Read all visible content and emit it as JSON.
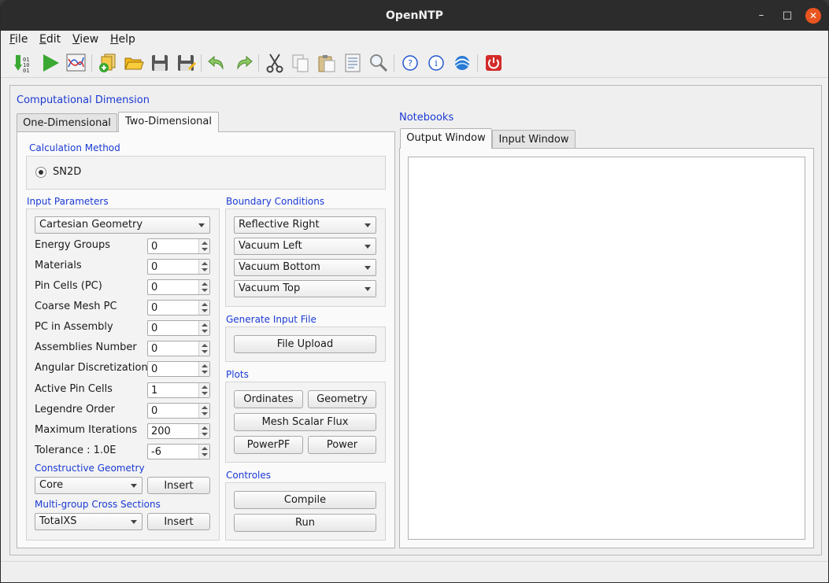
{
  "window": {
    "title": "OpenNTP"
  },
  "menu": [
    {
      "label": "File",
      "mnemonic": "F",
      "rest": "ile"
    },
    {
      "label": "Edit",
      "mnemonic": "E",
      "rest": "dit"
    },
    {
      "label": "View",
      "mnemonic": "V",
      "rest": "iew"
    },
    {
      "label": "Help",
      "mnemonic": "H",
      "rest": "elp"
    }
  ],
  "toolbar": {
    "icons": [
      "import-binary-icon",
      "run-icon",
      "plot-icon",
      "add-files-icon",
      "open-folder-icon",
      "save-icon",
      "save-as-icon",
      "undo-icon",
      "redo-icon",
      "cut-icon",
      "copy-icon",
      "paste-icon",
      "document-icon",
      "search-icon",
      "help-icon",
      "info-icon",
      "web-icon",
      "power-icon"
    ],
    "colors": {
      "green": "#3aa832",
      "folder": "#f2b818",
      "blue": "#2255cc",
      "red": "#d42a2a"
    }
  },
  "computational": {
    "title": "Computational Dimension",
    "tabs": [
      "One-Dimensional",
      "Two-Dimensional"
    ],
    "calculation_method": {
      "title": "Calculation Method",
      "option": "SN2D"
    },
    "input_parameters": {
      "title": "Input Parameters",
      "geometry": "Cartesian Geometry",
      "fields": [
        {
          "label": "Energy Groups",
          "value": "0"
        },
        {
          "label": "Materials",
          "value": "0"
        },
        {
          "label": "Pin Cells (PC)",
          "value": "0"
        },
        {
          "label": "Coarse Mesh PC",
          "value": "0"
        },
        {
          "label": "PC in Assembly",
          "value": "0"
        },
        {
          "label": "Assemblies Number",
          "value": "0"
        },
        {
          "label": "Angular Discretization",
          "value": "0"
        },
        {
          "label": "Active Pin Cells",
          "value": "1"
        },
        {
          "label": "Legendre Order",
          "value": "0"
        },
        {
          "label": "Maximum Iterations",
          "value": "200"
        },
        {
          "label": "Tolerance : 1.0E",
          "value": "-6"
        }
      ]
    },
    "constructive_geometry": {
      "title": "Constructive Geometry",
      "selected": "Core",
      "insert_label": "Insert"
    },
    "cross_sections": {
      "title": "Multi-group Cross Sections",
      "selected": "TotalXS",
      "insert_label": "Insert"
    },
    "boundary_conditions": {
      "title": "Boundary Conditions",
      "options": [
        "Reflective Right",
        "Vacuum Left",
        "Vacuum Bottom",
        "Vacuum Top"
      ]
    },
    "generate_input": {
      "title": "Generate Input File",
      "button": "File Upload"
    },
    "plots": {
      "title": "Plots",
      "ordinates": "Ordinates",
      "geometry": "Geometry",
      "mesh_scalar_flux": "Mesh Scalar Flux",
      "powerpf": "PowerPF",
      "power": "Power"
    },
    "controls": {
      "title": "Controles",
      "compile": "Compile",
      "run": "Run"
    }
  },
  "notebooks": {
    "title": "Notebooks",
    "tabs": [
      "Output Window",
      "Input Window"
    ]
  }
}
